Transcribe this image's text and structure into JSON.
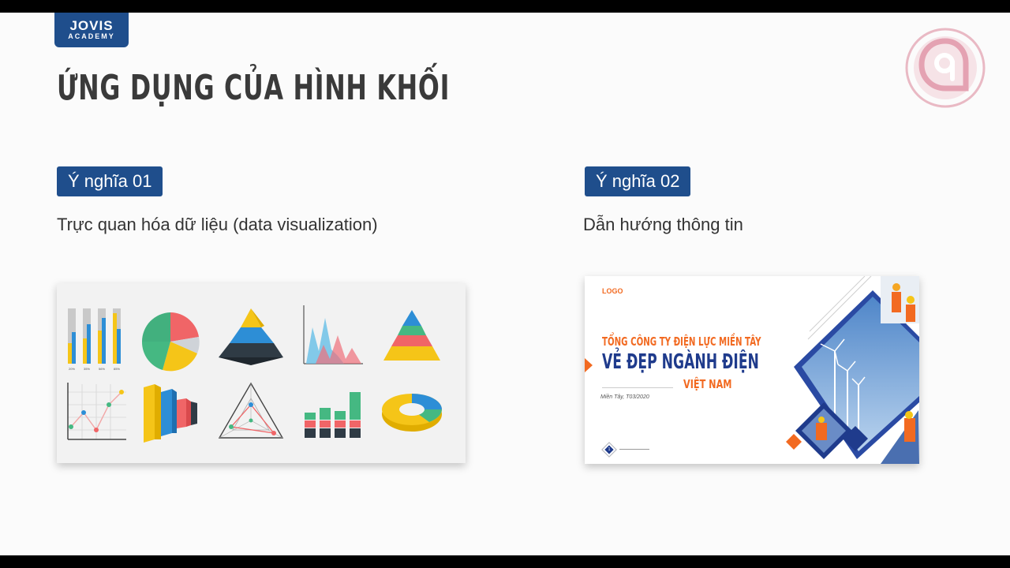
{
  "brand": {
    "line1": "JOVIS",
    "line2": "ACADEMY"
  },
  "title": "ỨNG DỤNG CỦA HÌNH KHỐI",
  "sections": [
    {
      "badge": "Ý nghĩa 01",
      "description": "Trực quan hóa dữ liệu (data visualization)"
    },
    {
      "badge": "Ý nghĩa 02",
      "description": "Dẫn hướng thông tin"
    }
  ],
  "left_card": {
    "bar_labels": [
      "20%",
      "35%",
      "56%",
      "85%"
    ]
  },
  "right_card": {
    "logo": "LOGO",
    "line1": "TỔNG CÔNG TY ĐIỆN LỰC MIỀN TÂY",
    "line2": "VẺ ĐẸP NGÀNH ĐIỆN",
    "line3": "VIỆT NAM",
    "date": "Miền Tây, T03/2020",
    "page": "1"
  },
  "colors": {
    "brand_blue": "#1f4e8c",
    "accent_orange": "#f26a21",
    "navy": "#1f3b8c",
    "title_gray": "#3a3a3a"
  }
}
